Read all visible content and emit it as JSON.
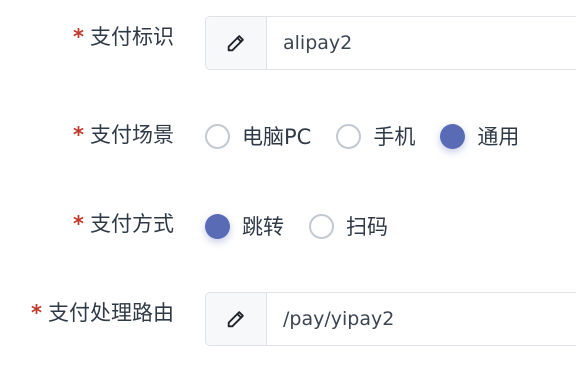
{
  "fields": {
    "pay_id": {
      "label": "支付标识",
      "required_mark": "*",
      "value": "alipay2",
      "icon": "pencil-icon"
    },
    "pay_scene": {
      "label": "支付场景",
      "required_mark": "*",
      "options": [
        {
          "label": "电脑PC",
          "checked": false
        },
        {
          "label": "手机",
          "checked": false
        },
        {
          "label": "通用",
          "checked": true
        }
      ]
    },
    "pay_method": {
      "label": "支付方式",
      "required_mark": "*",
      "options": [
        {
          "label": "跳转",
          "checked": true
        },
        {
          "label": "扫码",
          "checked": false
        }
      ]
    },
    "pay_route": {
      "label": "支付处理路由",
      "required_mark": "*",
      "value": "/pay/yipay2",
      "icon": "pencil-icon"
    }
  },
  "colors": {
    "accent": "#5a6bb5",
    "required": "#c0392b",
    "border": "#dfe3e8"
  }
}
